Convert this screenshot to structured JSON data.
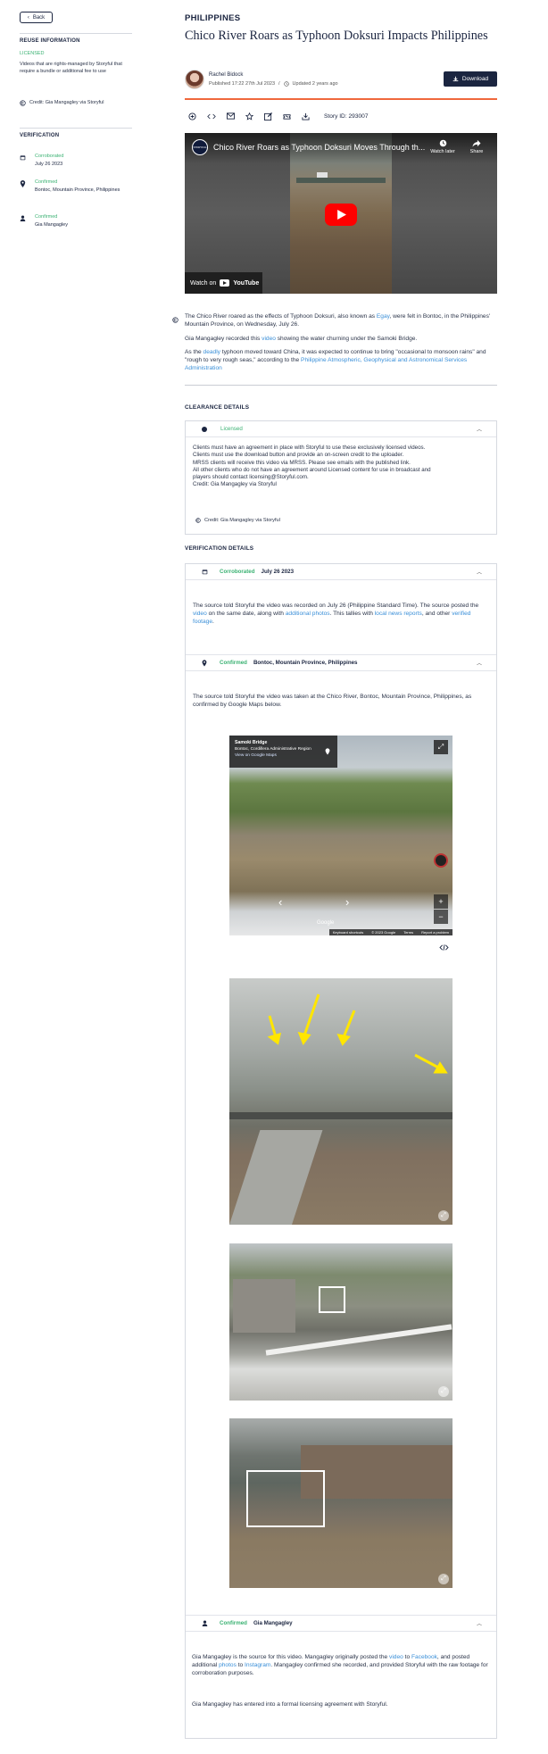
{
  "nav": {
    "back_label": "Back"
  },
  "sidebar": {
    "reuse_title": "REUSE INFORMATION",
    "license_status": "LICENSED",
    "license_desc": "Videos that are rights-managed by Storyful that require a bundle or additional fee to use",
    "credit": "Credit: Gia Mangagley via Storyful",
    "verification_title": "VERIFICATION",
    "items": [
      {
        "status": "Corroborated",
        "value": "July 26 2023",
        "icon": "calendar-icon"
      },
      {
        "status": "Confirmed",
        "value": "Bontoc, Mountain Province, Philippines",
        "icon": "location-pin-icon"
      },
      {
        "status": "Confirmed",
        "value": "Gia Mangagley",
        "icon": "person-icon"
      }
    ]
  },
  "article": {
    "category": "PHILIPPINES",
    "title": "Chico River Roars as Typhoon Doksuri Impacts Philippines",
    "author": "Rachel Bidock",
    "published": "Published 17:22 27th Jul 2023",
    "separator": "/",
    "updated": "Updated 2 years ago",
    "download_label": "Download",
    "story_id": "Story ID: 293007"
  },
  "video": {
    "logo": "STORYFUL",
    "title": "Chico River Roars as Typhoon Doksuri Moves Through th...",
    "watch_later": "Watch later",
    "share": "Share",
    "watch_on": "Watch on",
    "youtube": "YouTube"
  },
  "body": {
    "p1": {
      "a": "The Chico River roared as the effects of Typhoon Doksuri, also known as ",
      "link": "Egay",
      "b": ", were felt in Bontoc, in the Philippines' Mountain Province, on Wednesday, July 26."
    },
    "p2": {
      "a": "Gia Mangagley recorded this ",
      "link": "video",
      "b": " showing the water churning under the Samoki Bridge."
    },
    "p3": {
      "a": "As the ",
      "link1": "deadly",
      "b": " typhoon moved toward China, it was expected to continue to bring \"occasional to monsoon rains\" and \"rough to very rough seas,\" according to the ",
      "link2": "Philippine Atmospheric, Geophysical and Astronomical Services Administration"
    }
  },
  "clearance": {
    "heading": "CLEARANCE DETAILS",
    "status": "Licensed",
    "lines": [
      "Clients must have an agreement in place with Storyful to use these exclusively licensed videos.",
      "Clients must use the download button and provide an on-screen credit to the uploader.",
      "MRSS clients will receive this video via MRSS. Please see emails with the published link.",
      "All other clients who do not have an agreement around Licensed content for use in broadcast and",
      "players should contact licensing@Storyful.com.",
      "Credit: Gia Mangagley via Storyful"
    ],
    "credit": "Credit: Gia Mangagley via Storyful"
  },
  "verification": {
    "heading": "VERIFICATION DETAILS",
    "date": {
      "status": "Corroborated",
      "value": "July 26 2023",
      "t1": "The source told Storyful the video was recorded on July 26 (Philippine Standard Time). The source posted the ",
      "l1": "video",
      "t2": " on the same date, along with ",
      "l2": "additional photos",
      "t3": ". This tallies with ",
      "l3": "local news reports",
      "t4": ", and other ",
      "l4": "verified footage",
      "t5": "."
    },
    "location": {
      "status": "Confirmed",
      "value": "Bontoc, Mountain Province, Philippines",
      "text": "The source told Storyful the video was taken at the Chico River, Bontoc, Mountain Province, Philippines, as confirmed by Google Maps below.",
      "map_title": "Samoki Bridge",
      "map_sub": "Bontoc, Cordillera Administrative Region",
      "map_link": "View on Google Maps",
      "map_footer": [
        "Keyboard shortcuts",
        "© 2023 Google",
        "Terms",
        "Report a problem"
      ],
      "map_watermark": "Google"
    },
    "source": {
      "status": "Confirmed",
      "value": "Gia Mangagley",
      "t1": "Gia Mangagley is the source for this video. Mangagley originally posted the ",
      "l1": "video",
      "t2": " to ",
      "l2": "Facebook",
      "t3": ", and posted additional ",
      "l3": "photos",
      "t4": " to ",
      "l4": "Instagram",
      "t5": ". Mangagley confirmed she recorded, and provided Storyful with the raw footage for corroboration purposes.",
      "p2": "Gia Mangagley has entered into a formal licensing agreement with Storyful."
    }
  },
  "colors": {
    "accent": "#1b2540",
    "green": "#3bb273",
    "link": "#3a8fd8",
    "orange_rule": "#f0683c"
  }
}
